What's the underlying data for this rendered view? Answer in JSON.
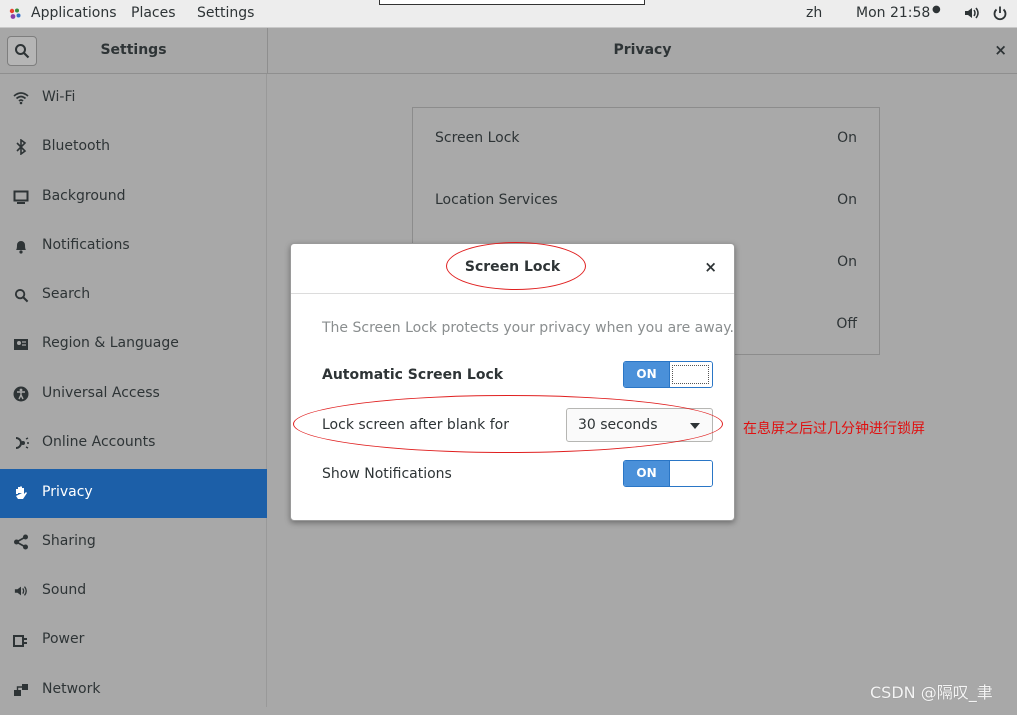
{
  "topbar": {
    "applications": "Applications",
    "places": "Places",
    "settings": "Settings",
    "input_method": "zh",
    "clock": "Mon 21:58",
    "volume_icon": "speaker-icon",
    "power_icon": "power-icon"
  },
  "header": {
    "search_icon": "search-icon",
    "settings_title": "Settings",
    "panel_title": "Privacy",
    "close": "×"
  },
  "sidebar": {
    "items": [
      {
        "label": "Wi-Fi",
        "icon": "wifi-icon"
      },
      {
        "label": "Bluetooth",
        "icon": "bluetooth-icon"
      },
      {
        "label": "Background",
        "icon": "monitor-icon"
      },
      {
        "label": "Notifications",
        "icon": "bell-icon"
      },
      {
        "label": "Search",
        "icon": "search-icon"
      },
      {
        "label": "Region & Language",
        "icon": "flag-icon"
      },
      {
        "label": "Universal Access",
        "icon": "accessibility-icon"
      },
      {
        "label": "Online Accounts",
        "icon": "online-accounts-icon"
      },
      {
        "label": "Privacy",
        "icon": "hand-icon",
        "active": true
      },
      {
        "label": "Sharing",
        "icon": "share-icon"
      },
      {
        "label": "Sound",
        "icon": "speaker-icon"
      },
      {
        "label": "Power",
        "icon": "power-plug-icon"
      },
      {
        "label": "Network",
        "icon": "network-icon"
      }
    ],
    "active_color": "#1c5fa8"
  },
  "privacy": {
    "rows": [
      {
        "label": "Screen Lock",
        "value": "On"
      },
      {
        "label": "Location Services",
        "value": "On"
      },
      {
        "label": "",
        "value": "On"
      },
      {
        "label": "",
        "value": "Off"
      }
    ]
  },
  "dialog": {
    "title": "Screen Lock",
    "close": "×",
    "description": "The Screen Lock protects your privacy when you are away.",
    "auto_lock_label": "Automatic Screen Lock",
    "auto_lock_state": "ON",
    "blank_label": "Lock screen after blank for",
    "blank_value": "30 seconds",
    "notifications_label": "Show Notifications",
    "notifications_state": "ON",
    "switch_color": "#4a90d9"
  },
  "annotation": {
    "text": "在息屏之后过几分钟进行锁屏",
    "color": "#e01010"
  },
  "watermark": "CSDN @隔叹_聿"
}
